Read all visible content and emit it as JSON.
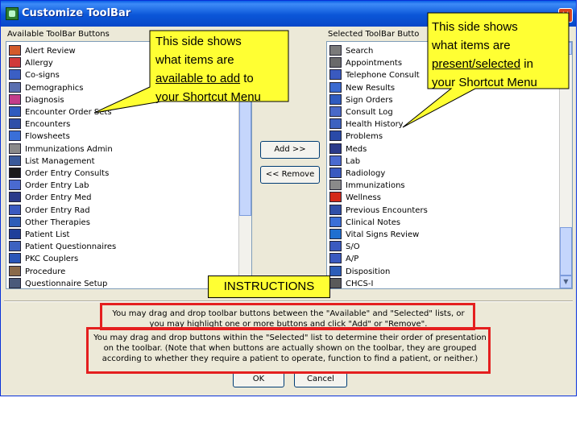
{
  "window": {
    "title": "Customize ToolBar",
    "close": "×"
  },
  "available": {
    "label": "Available ToolBar Buttons",
    "items": [
      {
        "label": "Alert Review",
        "icon": "alert-review-icon",
        "color": "#d35b2b"
      },
      {
        "label": "Allergy",
        "icon": "allergy-icon",
        "color": "#d13a3a"
      },
      {
        "label": "Co-signs",
        "icon": "cosign-icon",
        "color": "#3b5fc4"
      },
      {
        "label": "Demographics",
        "icon": "demographics-icon",
        "color": "#5a6fb0"
      },
      {
        "label": "Diagnosis",
        "icon": "diagnosis-icon",
        "color": "#c33e8a"
      },
      {
        "label": "Encounter Order Sets",
        "icon": "encounter-order-sets-icon",
        "color": "#2f5bbf"
      },
      {
        "label": "Encounters",
        "icon": "encounters-icon",
        "color": "#2f4fa8"
      },
      {
        "label": "Flowsheets",
        "icon": "flowsheets-icon",
        "color": "#3a6fd8"
      },
      {
        "label": "Immunizations Admin",
        "icon": "syringe-icon",
        "color": "#8a8a8a"
      },
      {
        "label": "List Management",
        "icon": "list-management-icon",
        "color": "#3a5a9a"
      },
      {
        "label": "Order Entry Consults",
        "icon": "order-consults-icon",
        "color": "#1b1b1b"
      },
      {
        "label": "Order Entry Lab",
        "icon": "order-lab-icon",
        "color": "#4a6ad0"
      },
      {
        "label": "Order Entry Med",
        "icon": "order-med-icon",
        "color": "#2b3a8a"
      },
      {
        "label": "Order Entry Rad",
        "icon": "order-rad-icon",
        "color": "#3a5ac0"
      },
      {
        "label": "Other Therapies",
        "icon": "other-therapies-icon",
        "color": "#2d5db8"
      },
      {
        "label": "Patient List",
        "icon": "patient-list-icon",
        "color": "#1f3f9a"
      },
      {
        "label": "Patient Questionnaires",
        "icon": "patient-questionnaires-icon",
        "color": "#3d62c0"
      },
      {
        "label": "PKC Couplers",
        "icon": "pkc-couplers-icon",
        "color": "#2a56b8"
      },
      {
        "label": "Procedure",
        "icon": "procedure-icon",
        "color": "#8a6a4a"
      },
      {
        "label": "Questionnaire Setup",
        "icon": "questionnaire-setup-icon",
        "color": "#4a5a7a"
      }
    ]
  },
  "selected": {
    "label": "Selected ToolBar Butto",
    "items": [
      {
        "label": "Search",
        "icon": "search-icon",
        "color": "#7a7a7a"
      },
      {
        "label": "Appointments",
        "icon": "appointments-icon",
        "color": "#6a6a6a"
      },
      {
        "label": "Telephone Consult",
        "icon": "telephone-icon",
        "color": "#3a5ac0"
      },
      {
        "label": "New Results",
        "icon": "new-results-icon",
        "color": "#3a6ad0"
      },
      {
        "label": "Sign Orders",
        "icon": "sign-orders-icon",
        "color": "#2f5bbf"
      },
      {
        "label": "Consult Log",
        "icon": "consult-log-icon",
        "color": "#4a6ac8"
      },
      {
        "label": "Health History",
        "icon": "health-history-icon",
        "color": "#3d62c0"
      },
      {
        "label": "Problems",
        "icon": "problems-icon",
        "color": "#2a4aa8"
      },
      {
        "label": "Meds",
        "icon": "meds-icon",
        "color": "#2b3a8a"
      },
      {
        "label": "Lab",
        "icon": "lab-icon",
        "color": "#4a6ad0"
      },
      {
        "label": "Radiology",
        "icon": "radiology-icon",
        "color": "#3a5ac0"
      },
      {
        "label": "Immunizations",
        "icon": "immunizations-icon",
        "color": "#8a8a8a"
      },
      {
        "label": "Wellness",
        "icon": "wellness-apple-icon",
        "color": "#d42a1a"
      },
      {
        "label": "Previous Encounters",
        "icon": "previous-encounters-icon",
        "color": "#2f4fa8"
      },
      {
        "label": "Clinical Notes",
        "icon": "clinical-notes-icon",
        "color": "#3a6fd8"
      },
      {
        "label": "Vital Signs Review",
        "icon": "vital-signs-icon",
        "color": "#1f6fd0"
      },
      {
        "label": "S/O",
        "icon": "so-icon",
        "color": "#3a5ac0"
      },
      {
        "label": "A/P",
        "icon": "ap-icon",
        "color": "#3a5ac0"
      },
      {
        "label": "Disposition",
        "icon": "disposition-icon",
        "color": "#2d5db8"
      },
      {
        "label": "CHCS-I",
        "icon": "chcs-icon",
        "color": "#5a5a5a"
      }
    ]
  },
  "buttons": {
    "add": "Add >>",
    "remove": "<< Remove",
    "ok": "OK",
    "cancel": "Cancel"
  },
  "instructions": {
    "line1": "You may drag and drop toolbar buttons between the \"Available\" and \"Selected\" lists, or",
    "line2": "you may highlight one or more buttons and click \"Add\" or \"Remove\".",
    "line3": "You may drag and drop buttons within the \"Selected\" list to determine their order of presentation",
    "line4": "on the toolbar. (Note that when buttons are actually shown on the toolbar, they are grouped",
    "line5": "according to whether they require a patient to operate, function to find a patient, or neither.)"
  },
  "callouts": {
    "left": {
      "line1": "This side shows",
      "line2": "what items are",
      "line3": "available to add",
      "line3_rest": " to",
      "line4": "your Shortcut Menu"
    },
    "right": {
      "line1": "This side shows",
      "line2": "what items are",
      "line3": "present/selected",
      "line3_rest": " in",
      "line4": "your Shortcut Menu"
    },
    "instructions_label": "INSTRUCTIONS"
  },
  "colors": {
    "callout_yellow": "#ffff33",
    "annotation_red": "#e41f1f",
    "xp_blue": "#0b56d8"
  }
}
